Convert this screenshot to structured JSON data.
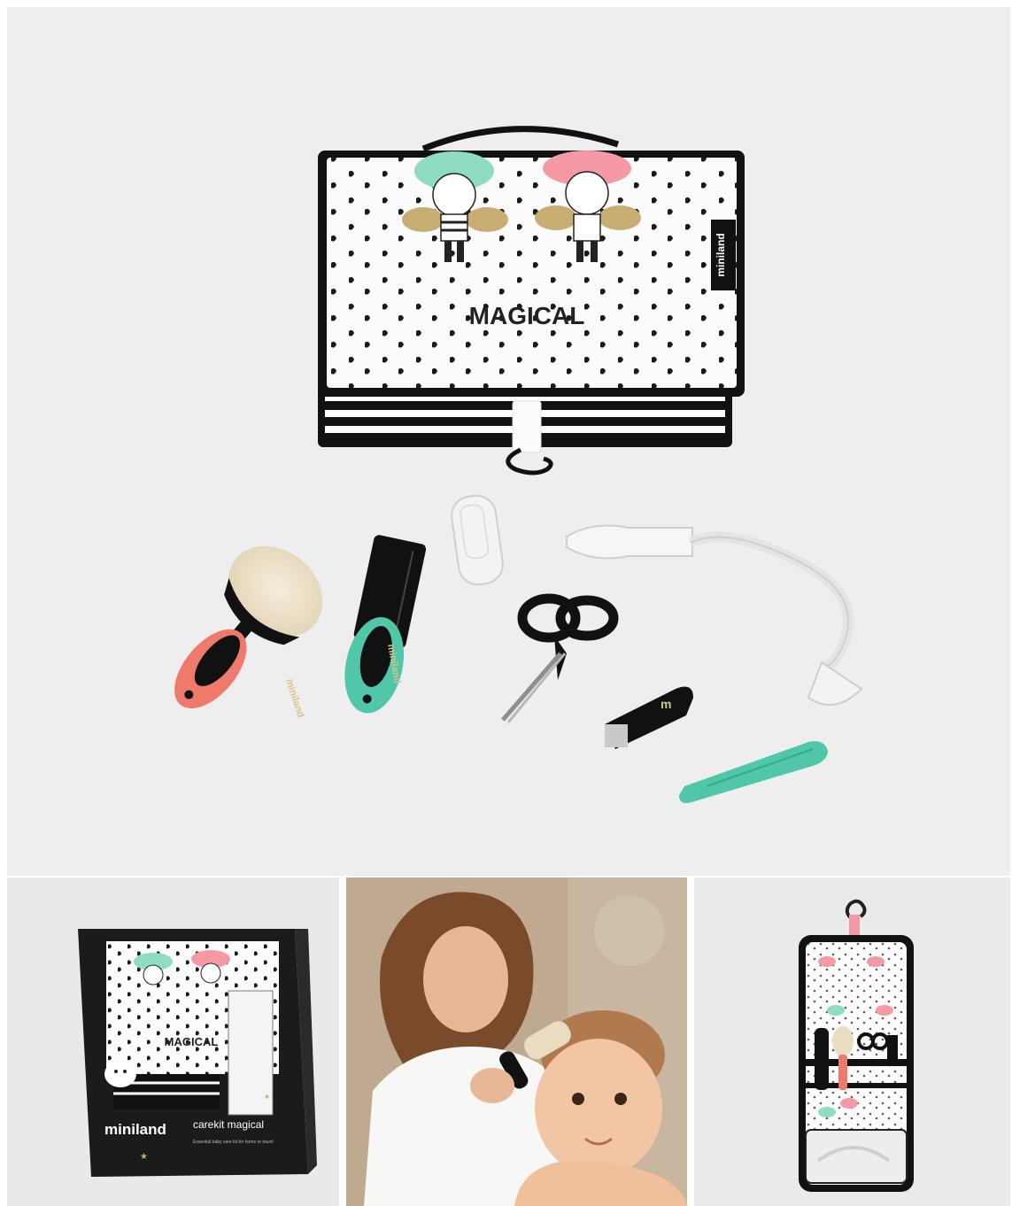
{
  "bag": {
    "print_title": "MAGICAL",
    "side_label_brand": "miniland"
  },
  "brush": {
    "handle_brand": "miniland"
  },
  "comb": {
    "handle_brand": "miniland"
  },
  "box": {
    "brand": "miniland",
    "product_name": "carekit magical",
    "tagline": "Essential baby care kit for home or travel",
    "print_title": "MAGICAL"
  },
  "colors": {
    "background": "#eeeeee",
    "coral": "#ef7a6c",
    "mint": "#4fc7a8",
    "black": "#111111",
    "pink_hair": "#f59aa4",
    "mint_hair": "#8fdcc5",
    "gold": "#c8ae73"
  }
}
